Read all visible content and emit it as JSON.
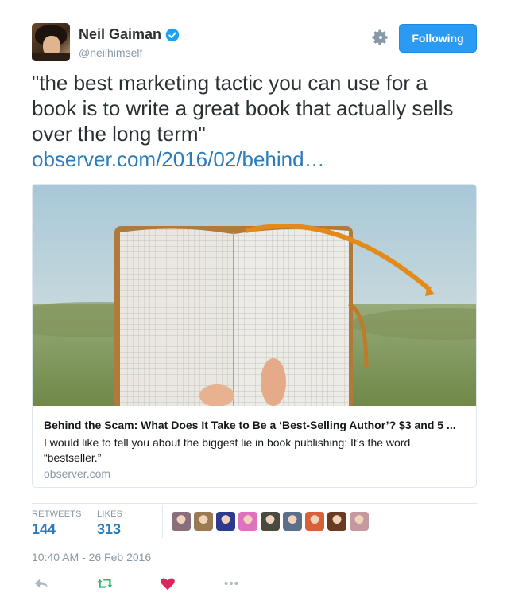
{
  "author": {
    "name": "Neil Gaiman",
    "handle": "@neilhimself"
  },
  "follow_button": {
    "label": "Following"
  },
  "tweet": {
    "text": "\"the best marketing tactic you can use for a book is to write a great book that actually sells over the long term\"",
    "link": "observer.com/2016/02/behind…"
  },
  "card": {
    "title": "Behind the Scam: What Does It Take to Be a ‘Best-Selling Author’? $3 and 5 ...",
    "description": "I would like to tell you about the biggest lie in book publishing: It’s the word “bestseller.”",
    "domain": "observer.com"
  },
  "stats": {
    "retweets_label": "RETWEETS",
    "retweets_value": "144",
    "likes_label": "LIKES",
    "likes_value": "313"
  },
  "likers": [
    {
      "color": "#8a6f7a"
    },
    {
      "color": "#9a7a52"
    },
    {
      "color": "#2c3a8f"
    },
    {
      "color": "#e070c0"
    },
    {
      "color": "#4a4a3e"
    },
    {
      "color": "#5b6f8a"
    },
    {
      "color": "#d9613a"
    },
    {
      "color": "#6b3a22"
    },
    {
      "color": "#c49aa0"
    }
  ],
  "timestamp": "10:40 AM - 26 Feb 2016",
  "colors": {
    "accent": "#2b9af3",
    "link": "#2b7bb9",
    "retweet": "#17bf63",
    "like": "#e0245e",
    "muted": "#8899a6"
  },
  "icons": {
    "verified": "verified-badge-icon",
    "settings": "gear-icon",
    "reply": "reply-icon",
    "retweet": "retweet-icon",
    "like": "heart-icon",
    "more": "more-dots-icon"
  }
}
